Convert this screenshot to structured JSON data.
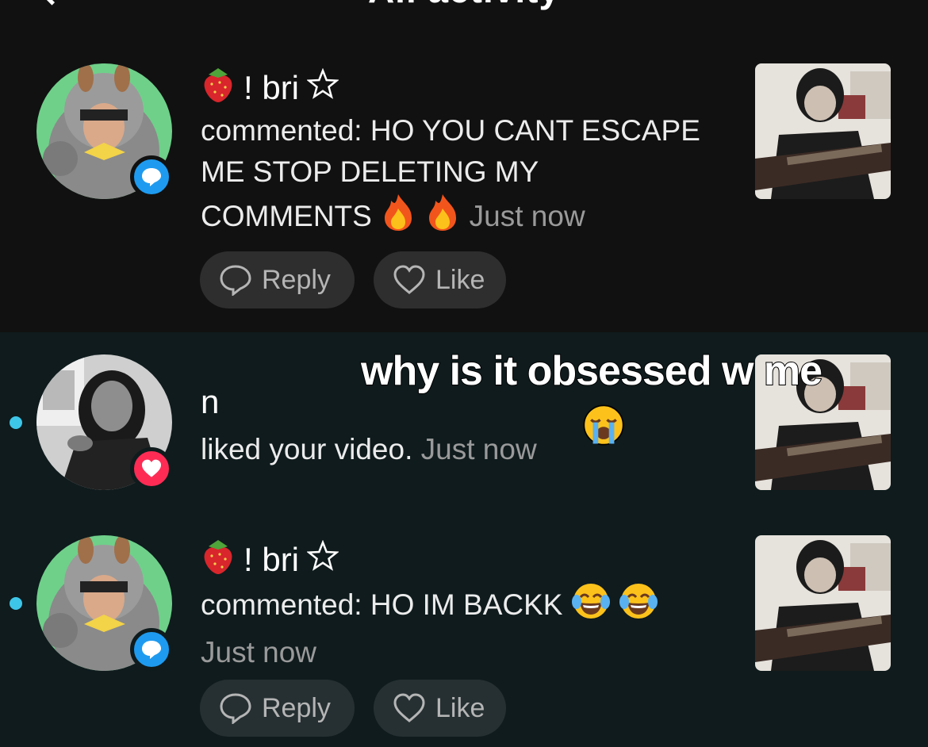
{
  "header": {
    "title": "All activity"
  },
  "notifications": [
    {
      "username": "! bri",
      "action": "commented:",
      "comment": "HO YOU CANT ESCAPE ME STOP DELETING MY COMMENTS",
      "emoji": [
        "fire-emoji",
        "fire-emoji"
      ],
      "time": "Just now",
      "badge": "comment-icon",
      "reply_label": "Reply",
      "like_label": "Like",
      "unread": false
    },
    {
      "username": "n",
      "action": "liked your video.",
      "time": "Just now",
      "badge": "heart-icon",
      "unread": true
    },
    {
      "username": "! bri",
      "action": "commented:",
      "comment": "HO IM BACKK",
      "emoji": [
        "laughing-tears-emoji",
        "laughing-tears-emoji"
      ],
      "time": "Just now",
      "badge": "comment-icon",
      "reply_label": "Reply",
      "like_label": "Like",
      "unread": true
    }
  ],
  "overlay": {
    "caption": "why is it obsessed w me",
    "emoji": "loudly-crying-emoji"
  },
  "colors": {
    "unread_dot": "#3ec6e8",
    "comment_badge": "#1e9bf0",
    "like_badge": "#fe2c55",
    "timestamp": "#9a9a9a"
  }
}
